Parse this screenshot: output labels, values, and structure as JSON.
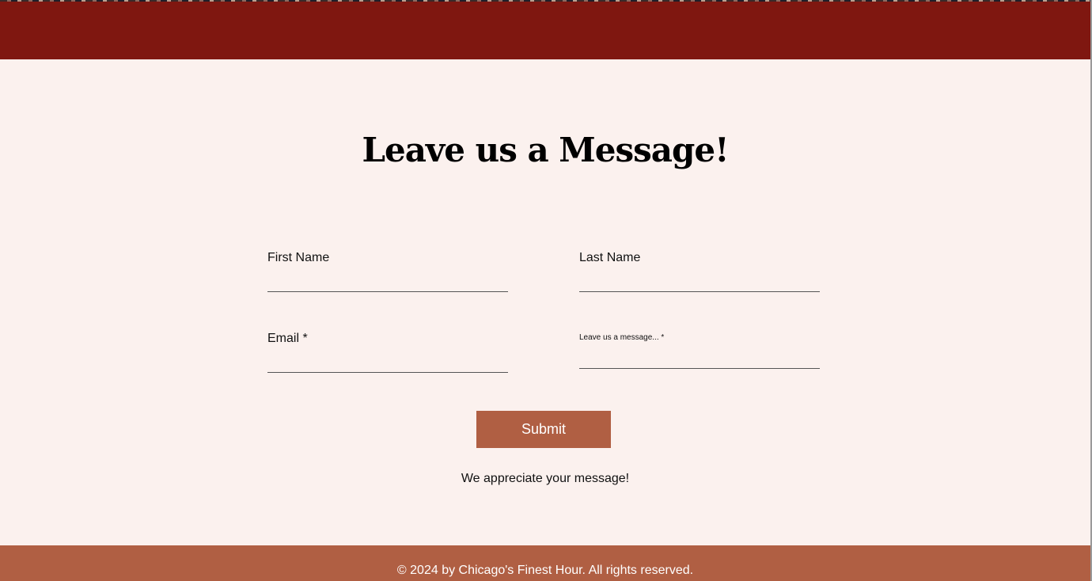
{
  "contact": {
    "heading": "Leave us a Message!",
    "first_name_label": "First Name",
    "last_name_label": "Last Name",
    "email_label": "Email *",
    "message_label": "Leave us a message... *",
    "first_name_value": "",
    "last_name_value": "",
    "email_value": "",
    "message_value": "",
    "submit_label": "Submit",
    "thanks": "We appreciate your message!"
  },
  "footer": {
    "copyright": "© 2024 by Chicago's Finest Hour. All rights reserved."
  },
  "colors": {
    "header_red": "#7f1710",
    "accent_brown": "#b05f43",
    "page_background": "#fbf1ee"
  }
}
